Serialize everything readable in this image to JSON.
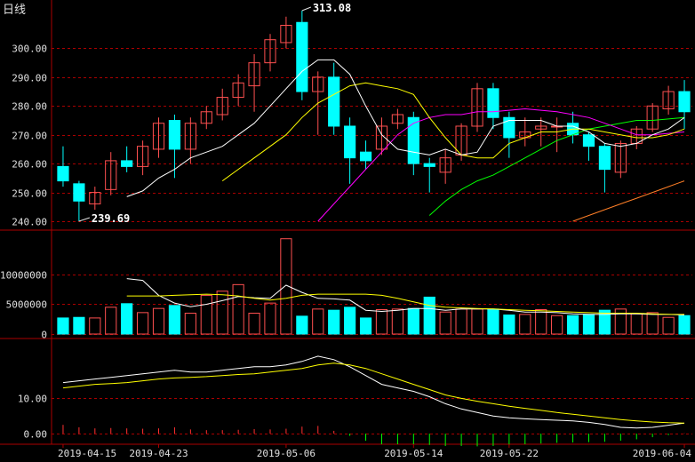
{
  "chart_data": {
    "type": "candlestick",
    "title": "日线",
    "colors": {
      "up": "#ff5050",
      "down": "#00ffff",
      "ma5": "#ffffff",
      "ma10": "#ffff00",
      "ma20": "#ff00ff",
      "ma30": "#00ff00",
      "ma60": "#ff7f27",
      "grid": "#aa0000",
      "axis_text": "#e0e0e0"
    },
    "price_panel": {
      "ylim": [
        240,
        310
      ],
      "yticks": [
        "300.00",
        "290.00",
        "280.00",
        "270.00",
        "260.00",
        "250.00",
        "240.00"
      ],
      "high_label": "313.08",
      "low_label": "239.69",
      "candles": [
        {
          "o": 259,
          "c": 254,
          "h": 266,
          "l": 252
        },
        {
          "o": 253,
          "c": 247,
          "h": 254,
          "l": 240
        },
        {
          "o": 246,
          "c": 250,
          "h": 252,
          "l": 244
        },
        {
          "o": 251,
          "c": 261,
          "h": 264,
          "l": 249
        },
        {
          "o": 261,
          "c": 259,
          "h": 266,
          "l": 257
        },
        {
          "o": 259,
          "c": 266,
          "h": 268,
          "l": 256
        },
        {
          "o": 265,
          "c": 274,
          "h": 276,
          "l": 262
        },
        {
          "o": 275,
          "c": 265,
          "h": 277,
          "l": 255
        },
        {
          "o": 265,
          "c": 274,
          "h": 276,
          "l": 260
        },
        {
          "o": 274,
          "c": 278,
          "h": 280,
          "l": 272
        },
        {
          "o": 277,
          "c": 283,
          "h": 286,
          "l": 275
        },
        {
          "o": 283,
          "c": 288,
          "h": 291,
          "l": 280
        },
        {
          "o": 287,
          "c": 295,
          "h": 298,
          "l": 278
        },
        {
          "o": 295,
          "c": 303,
          "h": 305,
          "l": 292
        },
        {
          "o": 302,
          "c": 308,
          "h": 311,
          "l": 300
        },
        {
          "o": 309,
          "c": 285,
          "h": 313.08,
          "l": 282
        },
        {
          "o": 285,
          "c": 290,
          "h": 292,
          "l": 270
        },
        {
          "o": 290,
          "c": 273,
          "h": 295,
          "l": 270
        },
        {
          "o": 273,
          "c": 262,
          "h": 276,
          "l": 253
        },
        {
          "o": 264,
          "c": 261,
          "h": 268,
          "l": 258
        },
        {
          "o": 265,
          "c": 273,
          "h": 276,
          "l": 263
        },
        {
          "o": 274,
          "c": 277,
          "h": 279,
          "l": 272
        },
        {
          "o": 276,
          "c": 260,
          "h": 278,
          "l": 256
        },
        {
          "o": 260,
          "c": 259,
          "h": 262,
          "l": 250
        },
        {
          "o": 257,
          "c": 262,
          "h": 265,
          "l": 253
        },
        {
          "o": 263,
          "c": 273,
          "h": 274,
          "l": 261
        },
        {
          "o": 273,
          "c": 286,
          "h": 288,
          "l": 271
        },
        {
          "o": 286,
          "c": 276,
          "h": 288,
          "l": 272
        },
        {
          "o": 276,
          "c": 269,
          "h": 278,
          "l": 262
        },
        {
          "o": 269,
          "c": 271,
          "h": 276,
          "l": 266
        },
        {
          "o": 272,
          "c": 273,
          "h": 276,
          "l": 266
        },
        {
          "o": 273,
          "c": 273,
          "h": 276,
          "l": 264
        },
        {
          "o": 274,
          "c": 270,
          "h": 278,
          "l": 267
        },
        {
          "o": 270,
          "c": 266,
          "h": 271,
          "l": 261
        },
        {
          "o": 266,
          "c": 258,
          "h": 267,
          "l": 250
        },
        {
          "o": 257,
          "c": 267,
          "h": 268,
          "l": 255
        },
        {
          "o": 267,
          "c": 272,
          "h": 273,
          "l": 265
        },
        {
          "o": 272,
          "c": 280,
          "h": 281,
          "l": 271
        },
        {
          "o": 279,
          "c": 285,
          "h": 287,
          "l": 277
        },
        {
          "o": 285,
          "c": 278,
          "h": 289,
          "l": 272
        }
      ],
      "ma5": [
        null,
        null,
        null,
        null,
        248.5,
        250.5,
        255,
        258,
        262,
        264,
        266,
        270,
        274,
        280,
        286,
        292,
        296,
        296,
        291,
        280,
        270,
        265,
        264,
        263,
        265,
        263,
        264,
        273,
        275,
        275,
        275,
        273,
        273,
        271,
        267,
        266,
        267,
        270,
        272,
        276
      ],
      "ma10": [
        null,
        null,
        null,
        null,
        null,
        null,
        null,
        null,
        null,
        null,
        254,
        258,
        262,
        266,
        270,
        276,
        281,
        284,
        287,
        288,
        287,
        286,
        284,
        276,
        269,
        263,
        262,
        262,
        267,
        269,
        271,
        271,
        272,
        272,
        271,
        270,
        269,
        269,
        270,
        272
      ],
      "ma20": [
        null,
        null,
        null,
        null,
        null,
        null,
        null,
        null,
        null,
        null,
        null,
        null,
        null,
        null,
        null,
        null,
        240,
        246,
        252,
        258,
        264,
        270,
        274,
        276,
        277,
        277,
        278,
        278,
        278.5,
        279,
        278.5,
        278,
        277,
        276,
        274,
        272,
        270,
        270,
        270.5,
        271
      ],
      "ma30": [
        null,
        null,
        null,
        null,
        null,
        null,
        null,
        null,
        null,
        null,
        null,
        null,
        null,
        null,
        null,
        null,
        null,
        null,
        null,
        null,
        null,
        null,
        null,
        242,
        247,
        251,
        254,
        256,
        259,
        262,
        265,
        268,
        270,
        272,
        273,
        274,
        275,
        275,
        275.5,
        276
      ],
      "ma60": [
        null,
        null,
        null,
        null,
        null,
        null,
        null,
        null,
        null,
        null,
        null,
        null,
        null,
        null,
        null,
        null,
        null,
        null,
        null,
        null,
        null,
        null,
        null,
        null,
        null,
        null,
        null,
        null,
        null,
        null,
        null,
        null,
        240,
        242,
        244,
        246,
        248,
        250,
        252,
        254
      ]
    },
    "volume_panel": {
      "ylim": [
        0,
        17000000
      ],
      "yticks": [
        "10000000",
        "5000000",
        "0"
      ],
      "values": [
        2700000,
        2800000,
        2700000,
        4500000,
        5100000,
        3600000,
        4300000,
        4800000,
        3500000,
        6500000,
        7200000,
        8300000,
        3500000,
        5200000,
        16000000,
        3000000,
        4200000,
        4000000,
        4500000,
        2700000,
        4100000,
        4200000,
        4300000,
        6200000,
        3700000,
        4200000,
        4200000,
        4200000,
        3200000,
        3300000,
        4100000,
        3100000,
        3100000,
        3300000,
        4000000,
        4200000,
        3400000,
        3600000,
        2800000,
        3100000
      ],
      "ma_short": [
        null,
        null,
        null,
        null,
        9300000,
        9000000,
        6500000,
        5200000,
        4600000,
        5000000,
        5600000,
        6300000,
        6100000,
        6000000,
        8200000,
        7000000,
        6000000,
        5900000,
        5700000,
        4000000,
        3800000,
        4000000,
        4300000,
        4300000,
        4000000,
        4200000,
        4200000,
        4200000,
        4000000,
        3700000,
        3700000,
        3600000,
        3400000,
        3300000,
        3300000,
        3400000,
        3400000,
        3300000,
        3300000,
        3200000
      ],
      "ma_long": [
        null,
        null,
        null,
        null,
        6400000,
        6400000,
        6400000,
        6500000,
        6600000,
        6700000,
        6600000,
        6400000,
        6000000,
        5700000,
        6000000,
        6500000,
        6700000,
        6700000,
        6700000,
        6700000,
        6500000,
        6000000,
        5400000,
        4800000,
        4500000,
        4400000,
        4300000,
        4200000,
        4100000,
        4000000,
        3900000,
        3800000,
        3700000,
        3600000,
        3500000,
        3500000,
        3500000,
        3400000,
        3300000,
        3300000
      ]
    },
    "indicator_panel": {
      "ylim": [
        -3,
        26
      ],
      "yticks": [
        "10.00",
        "0.00"
      ],
      "line1": [
        14.5,
        15,
        15.5,
        16,
        16.5,
        17,
        17.5,
        18,
        17.5,
        17.5,
        18,
        18.5,
        19,
        19,
        19.5,
        20.5,
        22,
        21,
        19,
        16.5,
        14,
        13,
        12,
        10.5,
        8.5,
        7,
        6,
        5,
        4.5,
        4.2,
        4,
        3.8,
        3.6,
        3.2,
        2.6,
        1.8,
        1.6,
        1.8,
        2.4,
        3
      ],
      "line2": [
        13,
        13.5,
        14,
        14.2,
        14.5,
        15,
        15.5,
        15.8,
        16,
        16.2,
        16.5,
        16.8,
        17,
        17.5,
        18,
        18.5,
        19.5,
        20,
        19.5,
        18.5,
        17,
        15.5,
        14,
        12.5,
        11,
        10,
        9.2,
        8.5,
        7.8,
        7.2,
        6.6,
        6,
        5.5,
        5,
        4.5,
        4,
        3.6,
        3.3,
        3.1,
        3
      ],
      "bars": [
        2.5,
        1.8,
        1.5,
        1.6,
        1.5,
        1.4,
        1.5,
        1.8,
        1.2,
        1.0,
        1.0,
        1.1,
        1.3,
        1.2,
        1.4,
        2.0,
        2.2,
        0.8,
        -0.6,
        -2.0,
        -3.0,
        -3.0,
        -3.0,
        -3.2,
        -3.5,
        -3.5,
        -3.6,
        -3.5,
        -3.3,
        -3.0,
        -2.8,
        -2.6,
        -2.5,
        -2.4,
        -2.3,
        -2.0,
        -1.6,
        -1.0,
        -0.4,
        0.1
      ]
    },
    "x_labels": [
      {
        "index": 0,
        "label": "2019-04-15"
      },
      {
        "index": 6,
        "label": "2019-04-23"
      },
      {
        "index": 14,
        "label": "2019-05-06"
      },
      {
        "index": 22,
        "label": "2019-05-14"
      },
      {
        "index": 28,
        "label": "2019-05-22"
      },
      {
        "index": 39,
        "label": "2019-06-04"
      }
    ]
  }
}
